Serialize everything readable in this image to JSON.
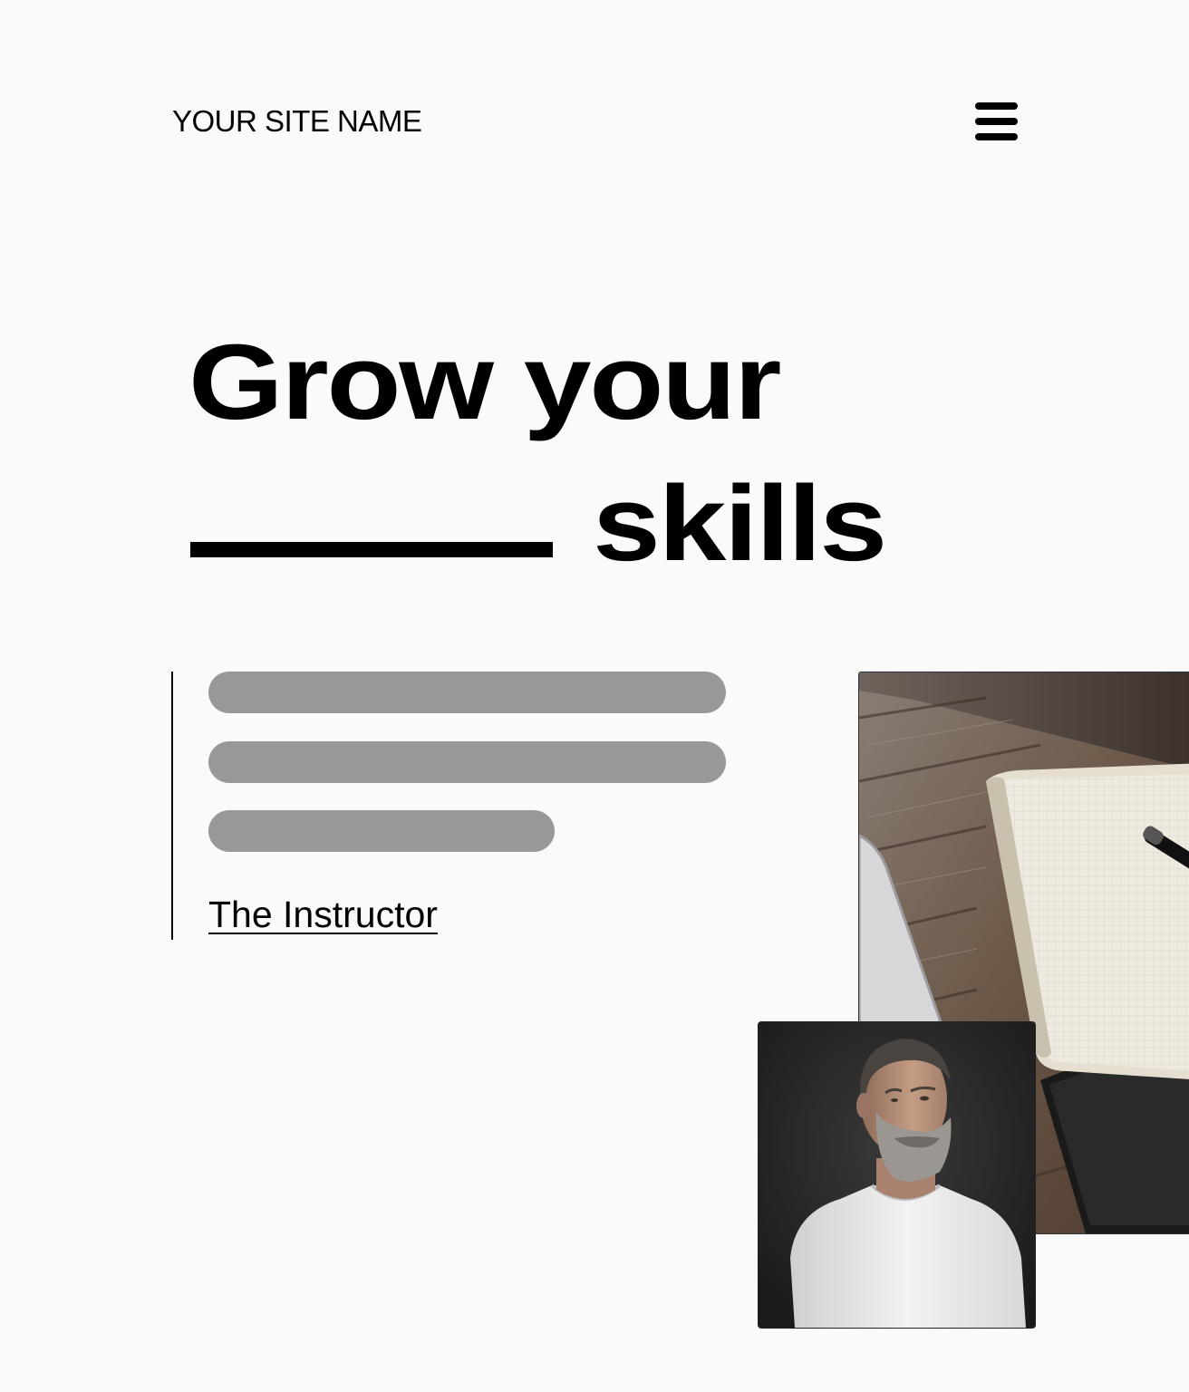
{
  "header": {
    "site_name": "YOUR SITE NAME",
    "menu_icon": "hamburger-menu-icon"
  },
  "hero": {
    "headline_line1": "Grow your",
    "headline_line2": "skills"
  },
  "quote": {
    "link_text": "The Instructor"
  },
  "colors": {
    "background": "#fafafa",
    "text": "#000000",
    "placeholder": "#989898"
  }
}
